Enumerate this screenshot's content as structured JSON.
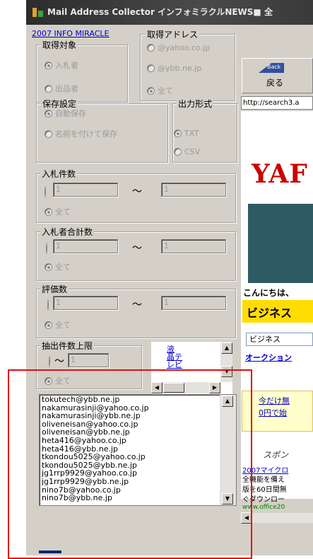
{
  "window": {
    "title": "Mail Address Collector  インフォミラクルNEWS■ 全"
  },
  "top_link": "2007 INFO MIRACLE",
  "acquire_target": {
    "label": "取得対象",
    "options": [
      "入札者",
      "出品者"
    ],
    "selected": "入札者"
  },
  "acquire_address": {
    "label": "取得アドレス",
    "options": [
      "@yahoo.co.jp",
      "@ybb.ne.jp",
      "全て"
    ],
    "selected": "全て"
  },
  "save_settings": {
    "label": "保存設定",
    "options": [
      "自動保存",
      "名前を付けて保存"
    ],
    "selected": "自動保存"
  },
  "output_format": {
    "label": "出力形式",
    "options": [
      "TXT",
      "CSV"
    ],
    "selected": "TXT"
  },
  "bid_count": {
    "label": "入札件数",
    "min": "1",
    "max": "1",
    "tilde": "～",
    "all_label": "全て"
  },
  "bidder_total": {
    "label": "入札者合計数",
    "min": "1",
    "max": "1",
    "tilde": "～",
    "all_label": "全て"
  },
  "rating": {
    "label": "評価数",
    "min": "1",
    "max": "1",
    "tilde": "～",
    "all_label": "全て"
  },
  "extract_limit": {
    "label": "抽出件数上限",
    "value": "1",
    "tilde": "～",
    "all_label": "全て"
  },
  "side_links": [
    "液",
    "晶テ",
    "レビ"
  ],
  "emails": [
    "tokutech@ybb.ne.jp",
    "nakamurasinji@yahoo.co.jp",
    "nakamurasinji@ybb.ne.jp",
    "oliveneisan@yahoo.co.jp",
    "oliveneisan@ybb.ne.jp",
    "heta416@yahoo.co.jp",
    "heta416@ybb.ne.jp",
    "tkondou5025@yahoo.co.jp",
    "tkondou5025@ybb.ne.jp",
    "jg1rrp9929@yahoo.co.jp",
    "jg1rrp9929@ybb.ne.jp",
    "nino7b@yahoo.co.jp",
    "nino7b@ybb.ne.jp"
  ],
  "browser": {
    "back_badge": "Back",
    "back_label": "戻る",
    "address": "http://search3.a",
    "logo": "YAF",
    "greeting": "こんにちは、",
    "business_title": "ビジネス",
    "dropdown_value": "ビジネス",
    "auction_link": "オークション",
    "promo_line1": "今だけ無",
    "promo_line2": "0円で始",
    "sponsor": "スポン",
    "ad_line1": "2007マイクロ",
    "ad_line2": "全機能を備え",
    "ad_line3": "版を60日間無",
    "ad_line4": "ぐダウンロー",
    "ad_url": "www.office20"
  },
  "colors": {
    "accent_red": "#e01010",
    "link_blue": "#0000cc",
    "yahoo_red": "#cc0000",
    "banner_teal": "#2e5a64",
    "promo_yellow": "#ffffcc",
    "business_yellow": "#ffdd00"
  }
}
